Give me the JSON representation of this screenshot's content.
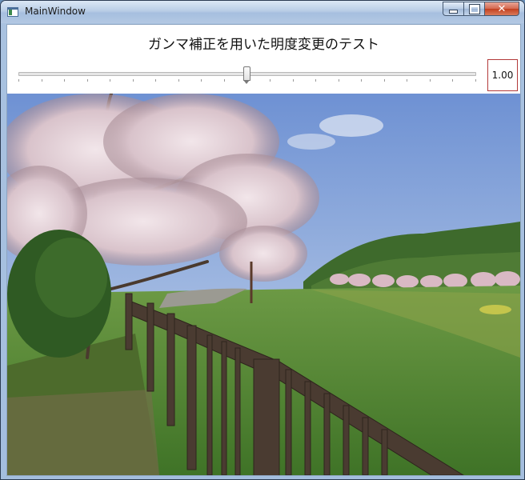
{
  "window": {
    "title": "MainWindow"
  },
  "heading": "ガンマ補正を用いた明度変更のテスト",
  "gamma_slider": {
    "value": 1.0,
    "min": 0.0,
    "max": 2.0,
    "tick_count": 21
  },
  "gamma_value_text": "1.00",
  "colors": {
    "value_box_border": "#b33a3a",
    "close_button": "#c2401f"
  },
  "icons": {
    "minimize": "minimize-icon",
    "maximize": "maximize-icon",
    "close": "close-icon",
    "app": "app-icon"
  }
}
